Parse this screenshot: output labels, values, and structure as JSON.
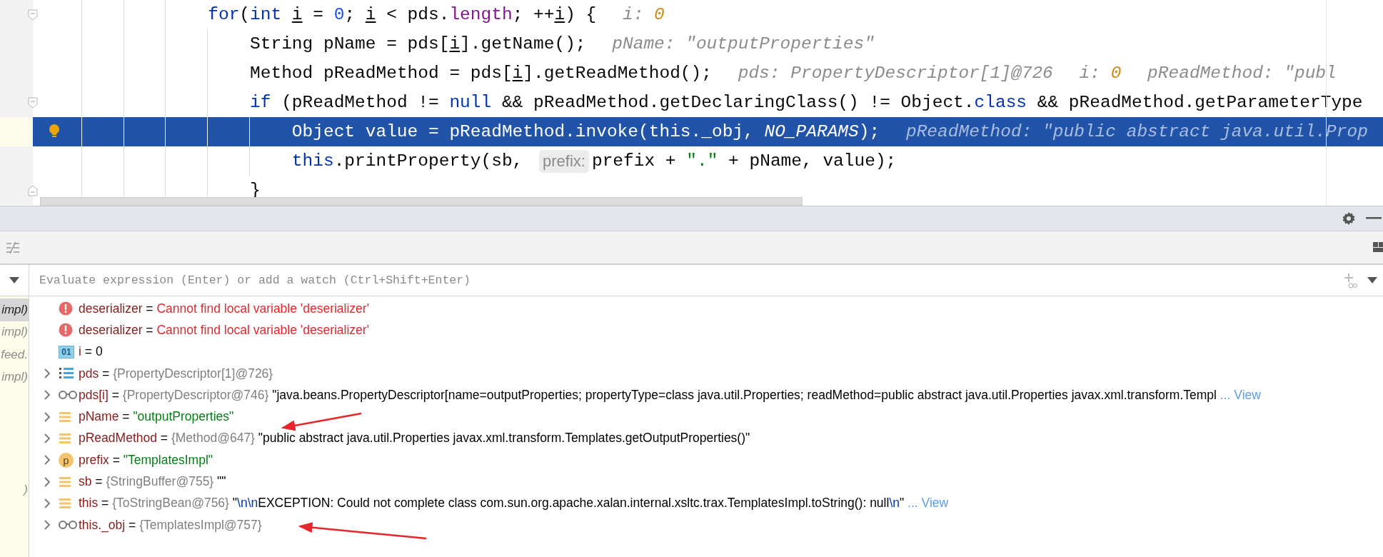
{
  "editor": {
    "lines": [
      {
        "gutter": {
          "kind": "fold-start"
        },
        "selected": false,
        "tokens": [
          {
            "kind": "keyword",
            "text": "                for"
          },
          {
            "kind": "plain",
            "text": "("
          },
          {
            "kind": "keyword",
            "text": "int "
          },
          {
            "kind": "underlined",
            "text": "i"
          },
          {
            "kind": "plain",
            "text": " = "
          },
          {
            "kind": "number",
            "text": "0"
          },
          {
            "kind": "plain",
            "text": "; "
          },
          {
            "kind": "underlined",
            "text": "i"
          },
          {
            "kind": "plain",
            "text": " < pds."
          },
          {
            "kind": "field",
            "text": "length"
          },
          {
            "kind": "plain",
            "text": "; ++"
          },
          {
            "kind": "underlined",
            "text": "i"
          },
          {
            "kind": "plain",
            "text": ") {"
          },
          {
            "kind": "hint",
            "text": "i: "
          },
          {
            "kind": "hint_number",
            "text": "0"
          }
        ]
      },
      {
        "selected": false,
        "tokens": [
          {
            "kind": "plain",
            "text": "                    String pName = pds["
          },
          {
            "kind": "underlined",
            "text": "i"
          },
          {
            "kind": "plain",
            "text": "].getName();"
          },
          {
            "kind": "hint",
            "text": "pName: \"outputProperties\""
          }
        ]
      },
      {
        "selected": false,
        "tokens": [
          {
            "kind": "plain",
            "text": "                    Method pReadMethod = pds["
          },
          {
            "kind": "underlined",
            "text": "i"
          },
          {
            "kind": "plain",
            "text": "].getReadMethod();"
          },
          {
            "kind": "hint",
            "text": "pds: PropertyDescriptor[1]@726"
          },
          {
            "kind": "hint",
            "text": "i: "
          },
          {
            "kind": "hint_number",
            "text": "0"
          },
          {
            "kind": "hint",
            "text": "pReadMethod: \"publ"
          }
        ]
      },
      {
        "gutter": {
          "kind": "fold-start"
        },
        "selected": false,
        "tokens": [
          {
            "kind": "keyword",
            "text": "                    if"
          },
          {
            "kind": "plain",
            "text": " (pReadMethod != "
          },
          {
            "kind": "keyword",
            "text": "null"
          },
          {
            "kind": "plain",
            "text": " && pReadMethod.getDeclaringClass() != Object."
          },
          {
            "kind": "keyword",
            "text": "class"
          },
          {
            "kind": "plain",
            "text": " && pReadMethod.getParameterType"
          }
        ]
      },
      {
        "gutter": {
          "kind": "bulb"
        },
        "selected": true,
        "tokens": [
          {
            "kind": "plain",
            "text": "                        Object value = pReadMethod.invoke(this._obj, "
          },
          {
            "kind": "constant",
            "text": "NO_PARAMS"
          },
          {
            "kind": "plain",
            "text": ");"
          },
          {
            "kind": "hint",
            "text": "pReadMethod: \"public abstract java.util.Prop"
          }
        ]
      },
      {
        "selected": false,
        "tokens": [
          {
            "kind": "keyword",
            "text": "                        this"
          },
          {
            "kind": "plain",
            "text": ".printProperty(sb, "
          },
          {
            "kind": "param_hint",
            "text": "prefix:"
          },
          {
            "kind": "plain",
            "text": "prefix + "
          },
          {
            "kind": "string",
            "text": "\".\""
          },
          {
            "kind": "plain",
            "text": " + pName, value);"
          }
        ]
      },
      {
        "gutter": {
          "kind": "fold-end"
        },
        "selected": false,
        "tokens": [
          {
            "kind": "plain",
            "text": "                    }"
          }
        ]
      }
    ]
  },
  "debugger": {
    "evaluate": {
      "placeholder": "Evaluate expression (Enter) or add a watch (Ctrl+Shift+Enter)"
    },
    "frames": [
      {
        "text": "impl)",
        "selected": true
      },
      {
        "text": "impl)",
        "selected": false
      },
      {
        "text": "feed.",
        "selected": false
      },
      {
        "text": "impl)",
        "selected": false
      },
      {
        "text": ")",
        "selected": false
      }
    ],
    "variables": [
      {
        "expandable": false,
        "kind": "error",
        "name": "deserializer",
        "separator": "=",
        "value": {
          "kind": "error",
          "text": "Cannot find local variable 'deserializer'"
        }
      },
      {
        "expandable": false,
        "kind": "error",
        "name": "deserializer",
        "separator": "=",
        "value": {
          "kind": "error",
          "text": "Cannot find local variable 'deserializer'"
        }
      },
      {
        "expandable": false,
        "kind": "int",
        "icon_label": "01",
        "name": "i",
        "separator": "=",
        "value": {
          "kind": "plain",
          "text": "0"
        }
      },
      {
        "expandable": true,
        "kind": "array",
        "name": "pds",
        "separator": "=",
        "value": {
          "kind": "object",
          "text": "{PropertyDescriptor[1]@726}"
        }
      },
      {
        "expandable": true,
        "kind": "watch",
        "name": "pds[i]",
        "separator": "=",
        "value": {
          "kind": "object",
          "text": "{PropertyDescriptor@746}"
        },
        "description": [
          {
            "kind": "text",
            "text": "\"java.beans.PropertyDescriptor[name=outputProperties; propertyType=class java.util.Properties; readMethod=public abstract java.util.Properties javax.xml.transform.Templ"
          }
        ],
        "link": "... View"
      },
      {
        "expandable": true,
        "kind": "field",
        "name": "pName",
        "separator": "=",
        "value": {
          "kind": "string",
          "text": "\"outputProperties\""
        }
      },
      {
        "expandable": true,
        "kind": "field",
        "name": "pReadMethod",
        "separator": "=",
        "value": {
          "kind": "object",
          "text": "{Method@647}"
        },
        "description": [
          {
            "kind": "text",
            "text": "\"public abstract java.util.Properties javax.xml.transform.Templates.getOutputProperties()\""
          }
        ]
      },
      {
        "expandable": true,
        "kind": "param",
        "icon_label": "p",
        "name": "prefix",
        "separator": "=",
        "value": {
          "kind": "string",
          "text": "\"TemplatesImpl\""
        }
      },
      {
        "expandable": true,
        "kind": "field",
        "name": "sb",
        "separator": "=",
        "value": {
          "kind": "object",
          "text": "{StringBuffer@755}"
        },
        "description": [
          {
            "kind": "text",
            "text": "\"\""
          }
        ]
      },
      {
        "expandable": true,
        "kind": "field",
        "name": "this",
        "separator": "=",
        "value": {
          "kind": "object",
          "text": "{ToStringBean@756}"
        },
        "description": [
          {
            "kind": "text",
            "text": "\""
          },
          {
            "kind": "escape",
            "text": "\\n\\n"
          },
          {
            "kind": "text",
            "text": "EXCEPTION: Could not complete class com.sun.org.apache.xalan.internal.xsltc.trax.TemplatesImpl.toString(): null"
          },
          {
            "kind": "escape",
            "text": "\\n"
          },
          {
            "kind": "text",
            "text": "\""
          }
        ],
        "link": "... View"
      },
      {
        "expandable": true,
        "kind": "watch",
        "name": "this._obj",
        "separator": "=",
        "value": {
          "kind": "object",
          "text": "{TemplatesImpl@757}"
        }
      }
    ]
  }
}
